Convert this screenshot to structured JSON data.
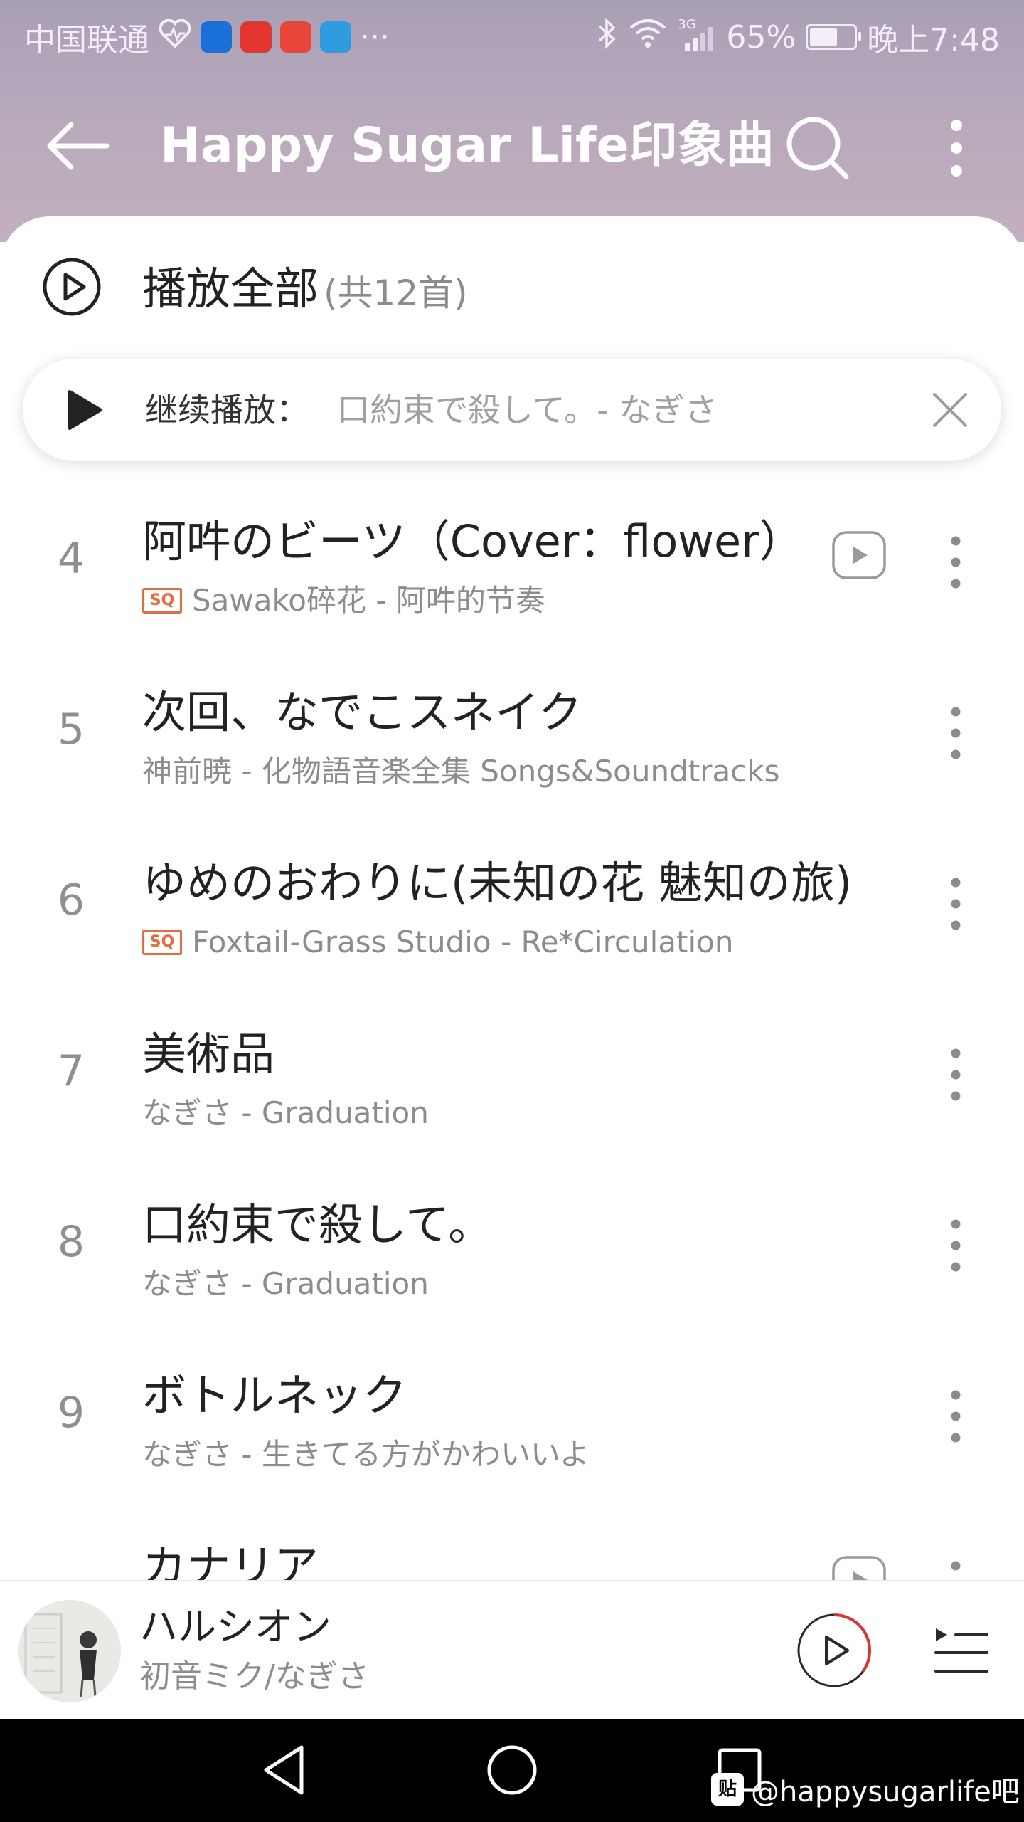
{
  "status_bar": {
    "carrier": "中国联通",
    "network": "3G",
    "battery": "65%",
    "time": "晚上7:48",
    "overflow": "···"
  },
  "header": {
    "title": "Happy Sugar Life印象曲",
    "back_icon": "arrow-left",
    "search_icon": "search",
    "more_icon": "more-vertical"
  },
  "play_all": {
    "label": "播放全部",
    "count": "(共12首)"
  },
  "resume": {
    "label": "继续播放：",
    "song": "口約束で殺して。- なぎさ"
  },
  "songs": [
    {
      "num": "4",
      "title": "阿吽のビーツ（Cover：flower）",
      "meta": "Sawako碎花 - 阿吽的节奏",
      "sq": true,
      "mv": true
    },
    {
      "num": "5",
      "title": "次回、なでこスネイク",
      "meta": "神前暁 - 化物語音楽全集 Songs&Soundtracks",
      "sq": false,
      "mv": false
    },
    {
      "num": "6",
      "title": "ゆめのおわりに(未知の花 魅知の旅)",
      "meta": "Foxtail-Grass Studio - Re*Circulation",
      "sq": true,
      "mv": false
    },
    {
      "num": "7",
      "title": "美術品",
      "meta": "なぎさ - Graduation",
      "sq": false,
      "mv": false
    },
    {
      "num": "8",
      "title": "口約束で殺して。",
      "meta": "なぎさ - Graduation",
      "sq": false,
      "mv": false
    },
    {
      "num": "9",
      "title": "ボトルネック",
      "meta": "なぎさ - 生きてる方がかわいいよ",
      "sq": false,
      "mv": false
    },
    {
      "num": "",
      "title": "カナリア",
      "meta": "",
      "sq": false,
      "mv": true
    }
  ],
  "sq_badge": "SQ",
  "player": {
    "title": "ハルシオン",
    "artist": "初音ミク/なぎさ",
    "progress": 0.35
  },
  "watermark": {
    "logo": "贴",
    "text": "@happysugarlife吧"
  },
  "colors": {
    "accent": "#e0312f",
    "sq": "#e96a3a",
    "header_bg": "#b4a6b9"
  }
}
